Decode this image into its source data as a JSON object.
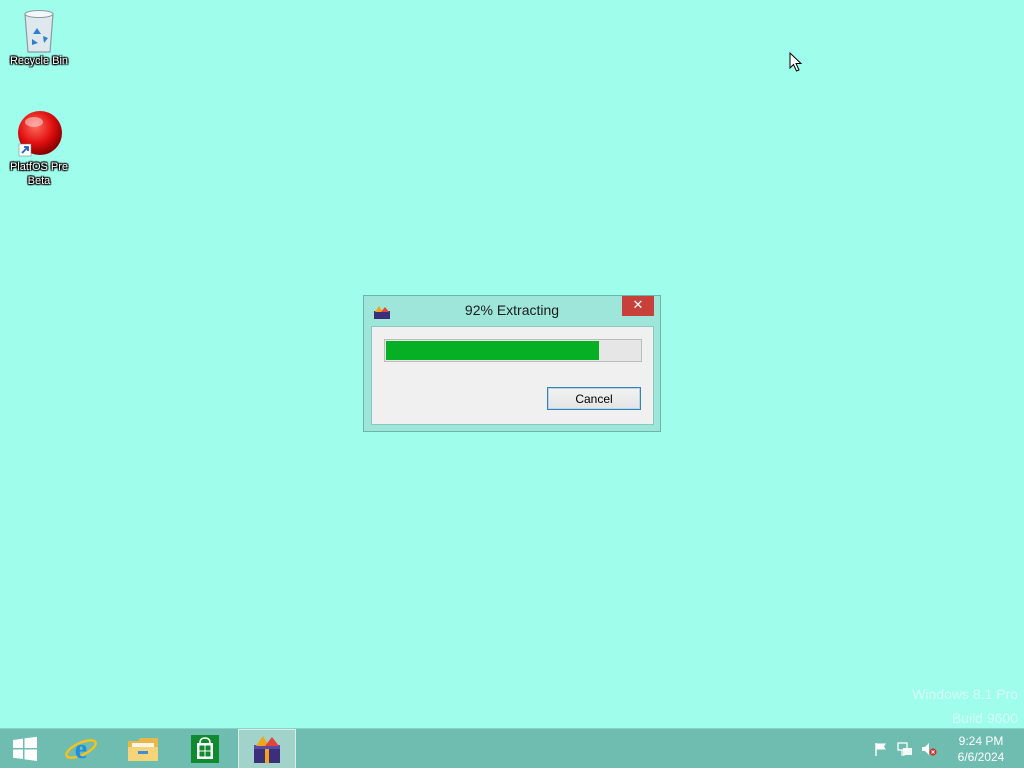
{
  "desktop": {
    "icons": [
      {
        "label": "Recycle Bin",
        "icon": "recycle-bin-icon"
      },
      {
        "label": "PlatfOS Pre Beta",
        "icon": "red-orb-shortcut-icon"
      }
    ],
    "watermark": {
      "line1": "Windows 8.1 Pro",
      "line2": "Build 9600"
    }
  },
  "dialog": {
    "title": "92% Extracting",
    "progress_fraction": 0.84,
    "close_symbol": "✕",
    "cancel_label": "Cancel"
  },
  "taskbar": {
    "buttons": [
      {
        "icon": "windows-start-icon"
      },
      {
        "icon": "internet-explorer-icon"
      },
      {
        "icon": "file-explorer-icon"
      },
      {
        "icon": "store-icon"
      },
      {
        "icon": "app-running-icon"
      }
    ],
    "tray": {
      "icons": [
        "action-center-flag-icon",
        "network-icon",
        "volume-muted-icon"
      ]
    },
    "clock": {
      "time": "9:24 PM",
      "date": "6/6/2024"
    }
  },
  "colors": {
    "desktop_bg": "#9ffdeb",
    "progress_green": "#06b025",
    "close_red": "#c7403a",
    "taskbar": "#6fbcb0"
  }
}
